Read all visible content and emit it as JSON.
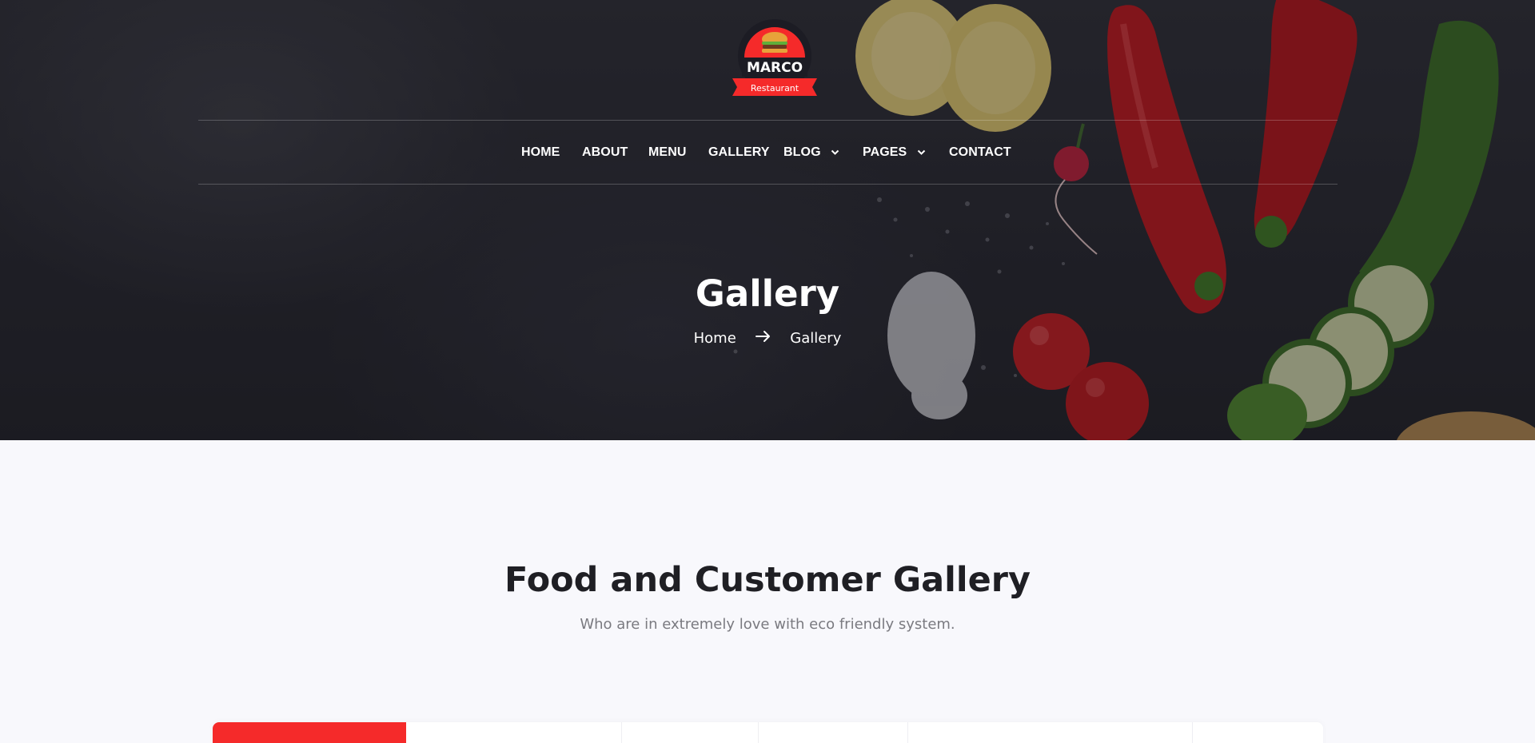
{
  "brand": {
    "name": "MARCO",
    "tagline": "Restaurant"
  },
  "nav": {
    "items": [
      {
        "label": "HOME"
      },
      {
        "label": "ABOUT"
      },
      {
        "label": "MENU"
      },
      {
        "label": "GALLERY"
      },
      {
        "label": "BLOG",
        "has_dropdown": true
      },
      {
        "label": "PAGES",
        "has_dropdown": true
      },
      {
        "label": "CONTACT"
      }
    ]
  },
  "hero": {
    "title": "Gallery",
    "breadcrumb": {
      "home": "Home",
      "current": "Gallery",
      "separator_icon": "arrow-right-icon"
    }
  },
  "gallery_section": {
    "title": "Food and Customer Gallery",
    "subtitle": "Who are in extremely love with eco friendly system."
  },
  "colors": {
    "accent": "#f52a2a",
    "hero_bg": "#26262e",
    "page_bg": "#f8f8fc",
    "heading": "#1f1f24",
    "muted_text": "#7a7a80"
  }
}
